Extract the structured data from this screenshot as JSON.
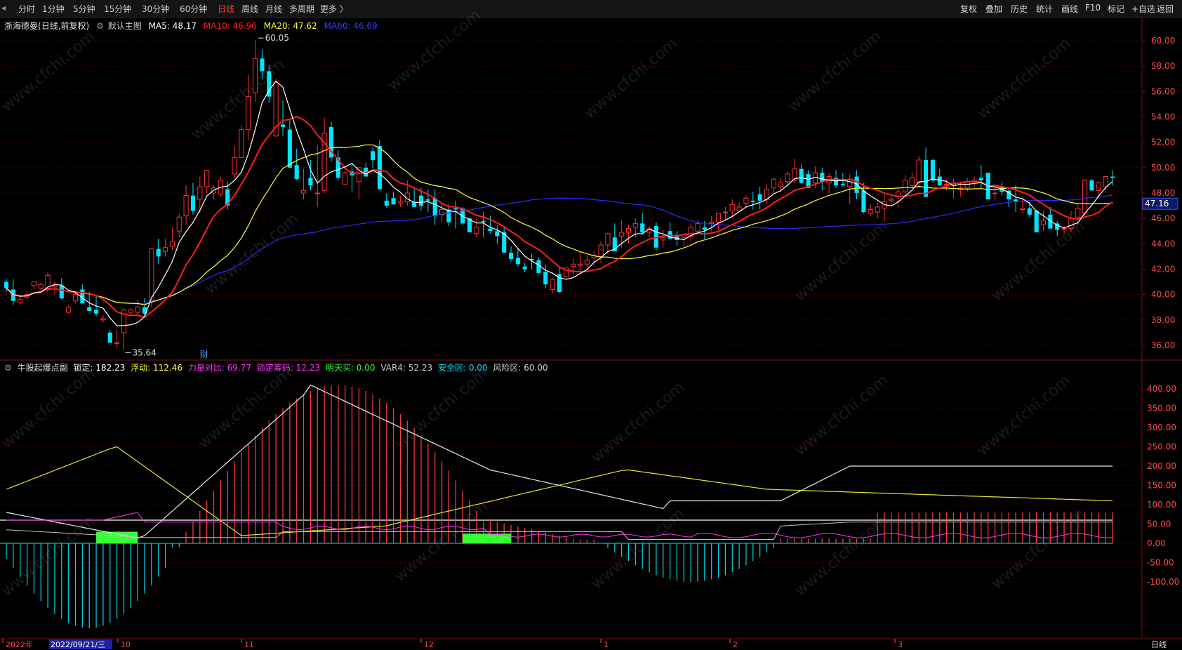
{
  "toolbar": {
    "periods": [
      "分时",
      "1分钟",
      "5分钟",
      "15分钟",
      "30分钟",
      "60分钟",
      "日线",
      "周线",
      "月线",
      "多周期",
      "更多 〉"
    ],
    "active_period": "日线",
    "right_buttons": [
      "复权",
      "叠加",
      "历史",
      "统计",
      "画线",
      "F10",
      "标记",
      "+自选",
      "返回"
    ]
  },
  "main_panel": {
    "stock": "浙海德曼",
    "mode": "(日线,前复权)",
    "template": "默认主图",
    "ma5": "MA5: 48.17",
    "ma10": "MA10: 46.96",
    "ma20": "MA20: 47.62",
    "ma60": "MA60: 46.69",
    "high_mark": "60.05",
    "low_mark": "35.64",
    "event_mark": "财",
    "last_price": "47.16",
    "y_ticks": [
      "60.00",
      "58.00",
      "56.00",
      "54.00",
      "52.00",
      "50.00",
      "48.00",
      "46.00",
      "44.00",
      "42.00",
      "40.00",
      "38.00",
      "36.00"
    ],
    "colors": {
      "up": "#ff3030",
      "down": "#00e5ff",
      "ma5": "#ffffff",
      "ma10": "#ff1e1e",
      "ma20": "#ffff33",
      "ma60": "#2a2aff"
    }
  },
  "sub_panel": {
    "name": "牛股起爆点副",
    "lock": "锁定: 182.23",
    "float": "浮动: 112.46",
    "power": "力量对比: 69.77",
    "lock_chip": "锁定筹码: 12.23",
    "buy_tomorrow": "明天买: 0.00",
    "var4": "VAR4: 52.23",
    "safe": "安全区: 0.00",
    "risk": "风险区: 60.00",
    "y_ticks": [
      "400.00",
      "350.00",
      "300.00",
      "250.00",
      "200.00",
      "150.00",
      "100.00",
      "50.00",
      "0.00",
      "-50.00",
      "-100.00"
    ]
  },
  "x_axis": {
    "labels": [
      "2022年",
      "2022/09/21/三",
      "10",
      "11",
      "12",
      "1",
      "2",
      "3"
    ],
    "period_label": "日线"
  },
  "watermark": "www.cfchi.com",
  "chart_data": {
    "type": "candlestick",
    "ylim": [
      35,
      61
    ],
    "candles": [
      [
        41.0,
        41.2,
        40.2,
        40.5
      ],
      [
        40.4,
        41.2,
        39.2,
        39.5
      ],
      [
        39.4,
        40.0,
        39.2,
        39.6
      ],
      [
        39.8,
        40.3,
        39.6,
        40.0
      ],
      [
        40.7,
        41.0,
        40.4,
        41.0
      ],
      [
        40.5,
        40.9,
        40.3,
        40.8
      ],
      [
        40.5,
        41.8,
        40.2,
        41.5
      ],
      [
        40.6,
        41.0,
        40.0,
        40.7
      ],
      [
        40.7,
        41.3,
        39.6,
        39.7
      ],
      [
        38.6,
        39.2,
        38.5,
        39.0
      ],
      [
        39.5,
        40.2,
        39.3,
        40.0
      ],
      [
        40.4,
        40.8,
        39.4,
        39.3
      ],
      [
        39.0,
        40.2,
        38.7,
        38.7
      ],
      [
        38.8,
        39.9,
        38.3,
        38.5
      ],
      [
        38.0,
        38.4,
        37.8,
        38.1
      ],
      [
        37.0,
        37.2,
        36.2,
        36.2
      ],
      [
        36.2,
        37.2,
        35.8,
        36.2
      ],
      [
        37.0,
        38.9,
        35.64,
        38.8
      ],
      [
        38.6,
        38.9,
        38.4,
        38.8
      ],
      [
        38.6,
        39.6,
        38.4,
        39.0
      ],
      [
        39.0,
        39.7,
        38.3,
        38.5
      ],
      [
        39.5,
        43.7,
        39.0,
        43.6
      ],
      [
        43.6,
        44.4,
        42.4,
        43.0
      ],
      [
        43.4,
        44.4,
        43.0,
        43.7
      ],
      [
        43.8,
        45.3,
        43.5,
        44.2
      ],
      [
        45.0,
        46.4,
        44.5,
        46.1
      ],
      [
        46.2,
        48.6,
        45.5,
        47.8
      ],
      [
        47.8,
        48.8,
        46.3,
        46.6
      ],
      [
        47.5,
        49.3,
        46.4,
        48.5
      ],
      [
        48.5,
        49.8,
        48.0,
        49.8
      ],
      [
        48.0,
        48.6,
        47.5,
        48.4
      ],
      [
        47.9,
        49.3,
        47.7,
        49.0
      ],
      [
        48.3,
        48.9,
        46.7,
        47.0
      ],
      [
        49.5,
        51.7,
        49.2,
        50.8
      ],
      [
        50.8,
        53.3,
        50.8,
        53.0
      ],
      [
        53.0,
        57.3,
        52.2,
        55.6
      ],
      [
        55.9,
        60.05,
        55.2,
        58.6
      ],
      [
        58.6,
        59.3,
        57.0,
        57.6
      ],
      [
        57.6,
        58.1,
        55.1,
        55.6
      ],
      [
        52.5,
        57.0,
        52.4,
        56.7
      ],
      [
        53.4,
        55.3,
        52.5,
        53.2
      ],
      [
        53.0,
        53.8,
        50.0,
        50.0
      ],
      [
        50.2,
        51.5,
        49.0,
        49.1
      ],
      [
        48.0,
        49.9,
        47.5,
        48.2
      ],
      [
        49.2,
        50.6,
        48.2,
        48.6
      ],
      [
        48.0,
        51.8,
        46.9,
        48.0
      ],
      [
        48.2,
        53.9,
        48.0,
        52.7
      ],
      [
        53.2,
        53.6,
        50.5,
        50.8
      ],
      [
        50.8,
        51.4,
        49.0,
        49.2
      ],
      [
        48.7,
        49.7,
        48.7,
        49.6
      ],
      [
        49.7,
        50.3,
        48.1,
        49.4
      ],
      [
        48.9,
        50.0,
        47.5,
        50.0
      ],
      [
        50.0,
        50.4,
        49.3,
        49.3
      ],
      [
        51.3,
        51.6,
        50.0,
        50.6
      ],
      [
        51.7,
        52.2,
        48.4,
        48.3
      ],
      [
        47.4,
        48.0,
        46.8,
        47.0
      ],
      [
        47.6,
        48.1,
        47.1,
        47.1
      ],
      [
        47.2,
        47.8,
        46.9,
        47.3
      ],
      [
        47.3,
        49.0,
        47.0,
        48.0
      ],
      [
        47.3,
        48.5,
        47.1,
        46.9
      ],
      [
        47.8,
        48.4,
        46.6,
        47.0
      ],
      [
        47.5,
        48.3,
        46.5,
        47.4
      ],
      [
        47.6,
        48.3,
        45.5,
        46.2
      ],
      [
        46.3,
        47.2,
        45.7,
        46.7
      ],
      [
        46.7,
        47.1,
        45.4,
        45.7
      ],
      [
        46.8,
        47.4,
        45.2,
        46.7
      ],
      [
        46.8,
        46.9,
        45.5,
        45.6
      ],
      [
        46.0,
        46.0,
        45.2,
        44.9
      ],
      [
        44.8,
        46.1,
        44.5,
        45.3
      ],
      [
        45.8,
        46.5,
        44.5,
        45.7
      ],
      [
        45.2,
        46.2,
        44.8,
        45.0
      ],
      [
        45.0,
        45.5,
        44.0,
        44.6
      ],
      [
        44.9,
        45.4,
        43.3,
        43.3
      ],
      [
        43.3,
        43.8,
        42.6,
        42.8
      ],
      [
        42.9,
        43.6,
        42.2,
        42.4
      ],
      [
        42.2,
        42.5,
        41.8,
        42.0
      ],
      [
        42.8,
        43.2,
        42.0,
        42.7
      ],
      [
        42.7,
        42.9,
        41.6,
        41.7
      ],
      [
        41.8,
        42.3,
        40.5,
        40.8
      ],
      [
        40.4,
        41.3,
        40.1,
        41.2
      ],
      [
        41.6,
        42.2,
        40.1,
        40.2
      ],
      [
        41.4,
        42.0,
        41.2,
        42.1
      ],
      [
        42.2,
        42.8,
        41.5,
        42.4
      ],
      [
        42.3,
        43.4,
        41.7,
        42.4
      ],
      [
        42.4,
        43.1,
        42.0,
        42.7
      ],
      [
        42.9,
        43.4,
        42.2,
        43.1
      ],
      [
        43.0,
        44.2,
        42.5,
        43.9
      ],
      [
        43.9,
        44.9,
        43.2,
        44.8
      ],
      [
        44.5,
        45.6,
        43.7,
        43.4
      ],
      [
        44.6,
        45.9,
        43.7,
        44.9
      ],
      [
        44.9,
        45.5,
        44.0,
        45.2
      ],
      [
        45.3,
        46.0,
        44.5,
        45.6
      ],
      [
        45.6,
        46.4,
        44.7,
        44.9
      ],
      [
        44.9,
        45.4,
        44.5,
        45.2
      ],
      [
        45.4,
        45.7,
        43.5,
        43.7
      ],
      [
        44.3,
        45.1,
        43.7,
        44.5
      ],
      [
        45.0,
        45.7,
        44.7,
        44.4
      ],
      [
        44.7,
        45.0,
        43.8,
        44.3
      ],
      [
        44.5,
        44.8,
        43.8,
        44.7
      ],
      [
        44.6,
        45.6,
        44.2,
        45.3
      ],
      [
        45.0,
        45.9,
        44.8,
        45.6
      ],
      [
        45.3,
        45.8,
        44.4,
        45.1
      ],
      [
        45.6,
        46.2,
        45.0,
        45.7
      ],
      [
        45.7,
        46.4,
        45.1,
        46.4
      ],
      [
        46.5,
        46.9,
        45.8,
        46.5
      ],
      [
        46.6,
        47.5,
        46.2,
        47.1
      ],
      [
        46.6,
        47.3,
        46.5,
        46.9
      ],
      [
        47.2,
        47.8,
        46.8,
        47.6
      ],
      [
        47.4,
        48.1,
        46.7,
        47.3
      ],
      [
        47.9,
        48.5,
        46.7,
        47.4
      ],
      [
        47.5,
        48.7,
        47.2,
        48.3
      ],
      [
        48.4,
        49.2,
        47.9,
        49.1
      ],
      [
        48.5,
        49.2,
        48.1,
        48.8
      ],
      [
        48.9,
        49.7,
        48.5,
        49.5
      ],
      [
        49.0,
        50.7,
        48.8,
        49.9
      ],
      [
        49.9,
        50.3,
        48.7,
        48.8
      ],
      [
        49.5,
        49.8,
        48.5,
        48.4
      ],
      [
        48.8,
        50.1,
        48.4,
        49.6
      ],
      [
        49.6,
        50.0,
        48.2,
        48.9
      ],
      [
        48.8,
        49.6,
        48.0,
        49.3
      ],
      [
        49.2,
        49.8,
        48.4,
        48.6
      ],
      [
        48.7,
        49.6,
        48.5,
        48.6
      ],
      [
        48.5,
        49.5,
        47.1,
        49.1
      ],
      [
        49.3,
        49.8,
        47.5,
        48.0
      ],
      [
        48.2,
        48.8,
        46.4,
        46.5
      ],
      [
        46.4,
        47.1,
        46.2,
        46.7
      ],
      [
        46.5,
        47.3,
        46.0,
        46.9
      ],
      [
        46.8,
        47.9,
        45.8,
        47.3
      ],
      [
        47.4,
        47.9,
        47.0,
        47.5
      ],
      [
        47.7,
        48.4,
        46.8,
        48.1
      ],
      [
        48.1,
        49.4,
        47.8,
        49.0
      ],
      [
        48.6,
        49.6,
        48.4,
        49.2
      ],
      [
        48.8,
        50.9,
        48.4,
        50.6
      ],
      [
        50.6,
        51.6,
        47.9,
        47.7
      ],
      [
        50.6,
        50.7,
        48.9,
        49.0
      ],
      [
        49.3,
        49.9,
        48.7,
        48.6
      ],
      [
        48.7,
        49.1,
        48.2,
        48.7
      ],
      [
        48.6,
        49.1,
        47.6,
        48.8
      ],
      [
        48.3,
        48.8,
        47.7,
        48.4
      ],
      [
        48.4,
        49.2,
        48.1,
        48.9
      ],
      [
        48.9,
        49.3,
        48.5,
        49.0
      ],
      [
        49.2,
        50.2,
        48.3,
        49.0
      ],
      [
        49.6,
        49.6,
        48.2,
        47.5
      ],
      [
        48.0,
        48.7,
        47.4,
        48.0
      ],
      [
        48.5,
        48.9,
        47.8,
        48.1
      ],
      [
        48.2,
        48.3,
        46.9,
        47.5
      ],
      [
        47.5,
        48.6,
        46.5,
        47.3
      ],
      [
        46.7,
        47.7,
        46.4,
        46.8
      ],
      [
        46.8,
        47.3,
        46.1,
        46.3
      ],
      [
        46.6,
        46.7,
        44.9,
        44.9
      ],
      [
        45.5,
        46.6,
        45.0,
        45.8
      ],
      [
        46.3,
        46.9,
        45.2,
        45.2
      ],
      [
        45.6,
        45.8,
        44.6,
        45.1
      ],
      [
        45.2,
        45.4,
        44.8,
        45.2
      ],
      [
        45.2,
        46.6,
        44.9,
        46.0
      ],
      [
        46.1,
        47.1,
        45.5,
        46.8
      ],
      [
        46.4,
        49.1,
        46.1,
        49.0
      ],
      [
        49.0,
        49.1,
        48.3,
        48.2
      ],
      [
        48.2,
        48.9,
        47.6,
        48.8
      ],
      [
        48.5,
        49.4,
        48.0,
        49.3
      ],
      [
        49.3,
        49.8,
        48.6,
        49.2
      ]
    ]
  }
}
